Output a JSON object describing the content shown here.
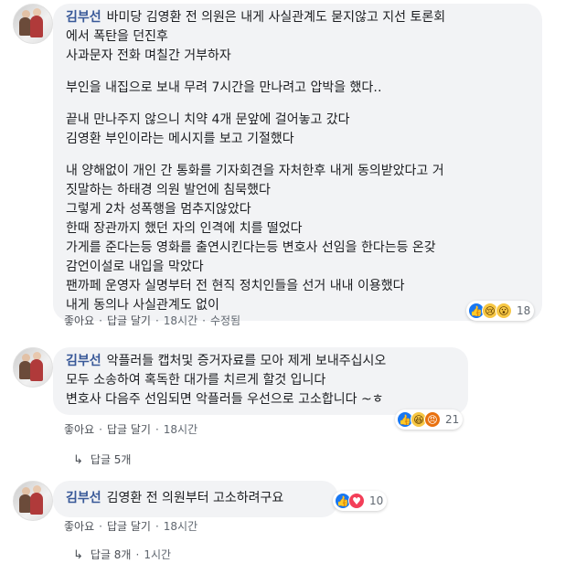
{
  "comments": [
    {
      "author": "김부선",
      "lines": [
        "바미당 김영환 전 의원은 내게 사실관계도 묻지않고 지선 토론회",
        "에서 폭탄을 던진후",
        "사과문자 전화 며칠간 거부하자",
        "",
        "부인을 내집으로 보내 무려 7시간을 만나려고 압박을 했다‥",
        "",
        "끝내 만나주지 않으니 치약 4개 문앞에 걸어놓고 갔다",
        "김영환 부인이라는 메시지를 보고 기절했다",
        "",
        "내 양해없이 개인 간 통화를 기자회견을 자처한후 내게 동의받았다고 거",
        "짓말하는 하태경 의원 발언에 침묵했다",
        "그렇게 2차 성폭행을 멈추지않았다",
        "한때 장관까지 했던 자의 인격에 치를 떨었다",
        "가게를 준다는등 영화를 출연시킨다는등 변호사 선임을 한다는등 온갖",
        "감언이설로 내입을 막았다",
        "팬까페 운영자 실명부터 전 현직 정치인들을 선거 내내 이용했다",
        "내게 동의나 사실관계도 없이"
      ],
      "actions": {
        "like": "좋아요",
        "reply": "답글 달기",
        "time": "18시간",
        "edited": "수정됨"
      },
      "reactions": {
        "icons": [
          "like",
          "sad",
          "wow"
        ],
        "count": "18"
      }
    },
    {
      "author": "김부선",
      "lines": [
        "악플러들 캡처및 증거자료를 모아 제게 보내주십시오",
        "모두 소송하여 혹독한 대가를 치르게 할것 입니다",
        "변호사 다음주 선임되면 악플러들 우선으로 고소합니다 ~ㅎ"
      ],
      "actions": {
        "like": "좋아요",
        "reply": "답글 달기",
        "time": "18시간"
      },
      "reactions": {
        "icons": [
          "like",
          "haha",
          "angry"
        ],
        "count": "21"
      },
      "replies_link": "답글 5개"
    },
    {
      "author": "김부선",
      "lines": [
        "김영환 전 의원부터 고소하려구요"
      ],
      "actions": {
        "like": "좋아요",
        "reply": "답글 달기",
        "time": "18시간"
      },
      "reactions": {
        "icons": [
          "like",
          "love"
        ],
        "count": "10"
      },
      "replies_link": "답글 8개",
      "replies_time": "1시간"
    }
  ]
}
